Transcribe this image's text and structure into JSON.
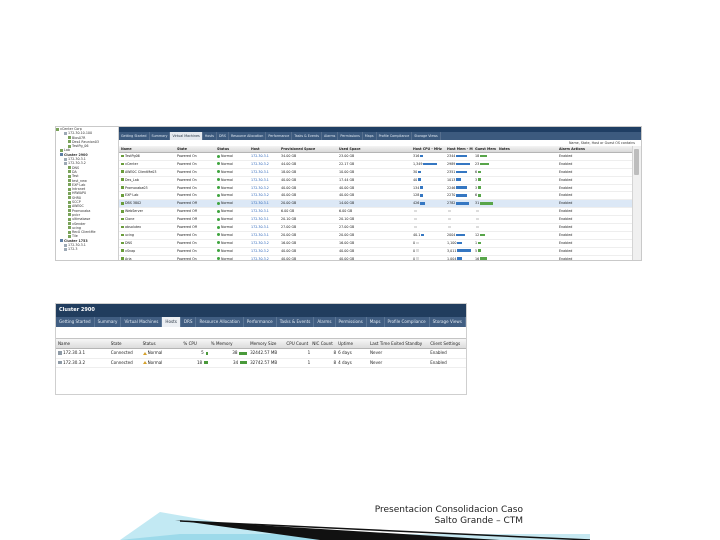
{
  "screenshot1": {
    "tree": [
      {
        "label": "vCenter Corp",
        "kind": "root"
      },
      {
        "label": "172.30.10.100",
        "kind": "host"
      },
      {
        "label": "Bios07R",
        "kind": "vm"
      },
      {
        "label": "Des4 Reunion03",
        "kind": "vm"
      },
      {
        "label": "TestPg_06",
        "kind": "vm"
      },
      {
        "label": "Lab",
        "kind": "folder"
      },
      {
        "label": "Cluster 2900",
        "kind": "cluster"
      },
      {
        "label": "172.30.3.1",
        "kind": "host"
      },
      {
        "label": "172.30.3.2",
        "kind": "host"
      },
      {
        "label": "DNS",
        "kind": "vm"
      },
      {
        "label": "DA",
        "kind": "vm"
      },
      {
        "label": "Test",
        "kind": "vm"
      },
      {
        "label": "test_new",
        "kind": "vm"
      },
      {
        "label": "EXP Lab",
        "kind": "vm"
      },
      {
        "label": "Intranet",
        "kind": "vm"
      },
      {
        "label": "HRWAP0",
        "kind": "vm"
      },
      {
        "label": "SHR0",
        "kind": "vm"
      },
      {
        "label": "SCCP",
        "kind": "vm"
      },
      {
        "label": "AWE0C",
        "kind": "vm"
      },
      {
        "label": "Promocaba",
        "kind": "vm"
      },
      {
        "label": "pvicr",
        "kind": "vm"
      },
      {
        "label": "ultimabase",
        "kind": "vm"
      },
      {
        "label": "vSender",
        "kind": "vm"
      },
      {
        "label": "ucing",
        "kind": "vm"
      },
      {
        "label": "Rec0 ClientMe",
        "kind": "vm"
      },
      {
        "label": "Tile",
        "kind": "vm"
      },
      {
        "label": "Cluster 1753",
        "kind": "cluster"
      },
      {
        "label": "172.30.3.1",
        "kind": "host"
      },
      {
        "label": "172.3",
        "kind": "host"
      }
    ],
    "tabs": [
      "Getting Started",
      "Summary",
      "Virtual Machines",
      "Hosts",
      "DRS",
      "Resource Allocation",
      "Performance",
      "Tasks & Events",
      "Alarms",
      "Permissions",
      "Maps",
      "Profile Compliance",
      "Storage Views"
    ],
    "active_tab": 2,
    "filter_text": "Name, State, Host or Guest OS contains",
    "columns": [
      "Name",
      "State",
      "Status",
      "Host",
      "Provisioned Space",
      "Used Space",
      "Host CPU - MHz",
      "Host Mem - MB",
      "Guest Mem - %",
      "Notes",
      "Alarm Actions"
    ],
    "rows": [
      {
        "name": "TestPg06",
        "state": "Powered On",
        "status": "Normal",
        "host": "172.30.3.1",
        "prov": "34.00 GB",
        "used": "23.00 GB",
        "cpu": "316",
        "mem": "2344",
        "guest": "18",
        "alarm": "Enabled"
      },
      {
        "name": "vCenter",
        "state": "Powered On",
        "status": "Normal",
        "host": "172.30.3.2",
        "prov": "44.00 GB",
        "used": "22.17 GB",
        "cpu": "1,349",
        "mem": "2989",
        "guest": "23",
        "alarm": "Enabled"
      },
      {
        "name": "AWE0C ClientMe03",
        "state": "Powered On",
        "status": "Normal",
        "host": "172.30.3.1",
        "prov": "18.00 GB",
        "used": "10.00 GB",
        "cpu": "30",
        "mem": "2351",
        "guest": "6",
        "alarm": "Enabled"
      },
      {
        "name": "Des_Lab",
        "state": "Powered On",
        "status": "Normal",
        "host": "172.30.3.1",
        "prov": "40.00 GB",
        "used": "17.44 GB",
        "cpu": "40",
        "mem": "1013",
        "guest": "3",
        "alarm": "Enabled"
      },
      {
        "name": "Promocaba03",
        "state": "Powered On",
        "status": "Normal",
        "host": "172.30.3.2",
        "prov": "40.00 GB",
        "used": "40.00 GB",
        "cpu": "134",
        "mem": "2246",
        "guest": "3",
        "alarm": "Enabled"
      },
      {
        "name": "EXP Lab",
        "state": "Powered On",
        "status": "Normal",
        "host": "172.30.3.2",
        "prov": "40.00 GB",
        "used": "40.00 GB",
        "cpu": "128",
        "mem": "2270",
        "guest": "6",
        "alarm": "Enabled"
      },
      {
        "name": "DBS 3802",
        "state": "Powered Off",
        "status": "Normal",
        "host": "172.30.3.1",
        "prov": "20.00 GB",
        "used": "14.00 GB",
        "cpu": "426",
        "mem": "2782",
        "guest": "31",
        "alarm": "Enabled"
      },
      {
        "name": "WebServer",
        "state": "Powered Off",
        "status": "Normal",
        "host": "172.30.3.1",
        "prov": "6.00 GB",
        "used": "6.00 GB",
        "cpu": "",
        "mem": "",
        "guest": "",
        "alarm": "Enabled"
      },
      {
        "name": "Clone",
        "state": "Powered Off",
        "status": "Normal",
        "host": "172.30.3.1",
        "prov": "20.10 GB",
        "used": "20.10 GB",
        "cpu": "",
        "mem": "",
        "guest": "",
        "alarm": "Enabled"
      },
      {
        "name": "absolutex",
        "state": "Powered Off",
        "status": "Normal",
        "host": "172.30.3.1",
        "prov": "27.00 GB",
        "used": "27.00 GB",
        "cpu": "",
        "mem": "",
        "guest": "",
        "alarm": "Enabled"
      },
      {
        "name": "ucing",
        "state": "Powered On",
        "status": "Normal",
        "host": "172.30.3.1",
        "prov": "20.00 GB",
        "used": "20.00 GB",
        "cpu": "40.1",
        "mem": "2004",
        "guest": "12",
        "alarm": "Enabled"
      },
      {
        "name": "DNS",
        "state": "Powered On",
        "status": "Normal",
        "host": "172.30.3.2",
        "prov": "16.00 GB",
        "used": "16.00 GB",
        "cpu": "0",
        "mem": "1,100",
        "guest": "1",
        "alarm": "Enabled"
      },
      {
        "name": "vSnap",
        "state": "Powered On",
        "status": "Normal",
        "host": "172.30.3.2",
        "prov": "40.00 GB",
        "used": "40.00 GB",
        "cpu": "0",
        "mem": "3,011",
        "guest": "5",
        "alarm": "Enabled"
      },
      {
        "name": "Aria",
        "state": "Powered On",
        "status": "Normal",
        "host": "172.30.3.2",
        "prov": "40.00 GB",
        "used": "40.00 GB",
        "cpu": "0",
        "mem": "1,004",
        "guest": "16",
        "alarm": "Enabled"
      },
      {
        "name": "SNCPanes",
        "state": "Powered On",
        "status": "Normal",
        "host": "172.30.3.2",
        "prov": "40.00 GB",
        "used": "40.00 GB",
        "cpu": "0",
        "mem": "1,001",
        "guest": "3",
        "alarm": "Enabled"
      },
      {
        "name": "mis_rev",
        "state": "Powered On",
        "status": "Normal",
        "host": "172.30.3.1",
        "prov": "40.00 GB",
        "used": "40.00 GB",
        "cpu": "0",
        "mem": "1,011",
        "guest": "3",
        "alarm": "Enabled"
      }
    ]
  },
  "screenshot2": {
    "title": "Cluster 2900",
    "tabs": [
      "Getting Started",
      "Summary",
      "Virtual Machines",
      "Hosts",
      "DRS",
      "Resource Allocation",
      "Performance",
      "Tasks & Events",
      "Alarms",
      "Permissions",
      "Maps",
      "Profile Compliance",
      "Storage Views"
    ],
    "active_tab": 3,
    "columns": [
      "Name",
      "State",
      "Status",
      "% CPU",
      "% Memory",
      "Memory Size",
      "CPU Count",
      "NIC Count",
      "Uptime",
      "Last Time Exited Standby",
      "Client Settings"
    ],
    "rows": [
      {
        "name": "172.30.3.1",
        "state": "Connected",
        "status": "Normal",
        "cpu": "5",
        "mem": "38",
        "memsize": "32442.57 MB",
        "cpucount": "1",
        "nic": "8",
        "uptime": "6 days",
        "standby": "Never",
        "client": "Enabled",
        "cpu_pct": 5,
        "mem_pct": 38
      },
      {
        "name": "172.30.3.2",
        "state": "Connected",
        "status": "Normal",
        "cpu": "18",
        "mem": "34",
        "memsize": "32742.57 MB",
        "cpucount": "1",
        "nic": "8",
        "uptime": "4 days",
        "standby": "Never",
        "client": "Enabled",
        "cpu_pct": 18,
        "mem_pct": 34
      }
    ]
  },
  "caption": {
    "line1": "Presentacion Consolidacion Caso",
    "line2": "Salto Grande – CTM"
  },
  "colors": {
    "nav_dark": "#1f3e63",
    "tab_bar": "#3c5a7e",
    "status_green": "#3fa43f",
    "footer_teal": "#1aa3c8",
    "footer_black": "#111111"
  }
}
